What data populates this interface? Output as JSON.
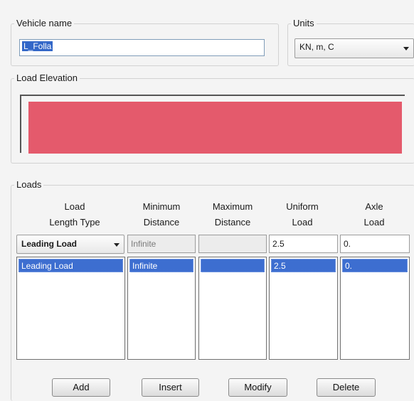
{
  "vehicle": {
    "title": "Vehicle name",
    "value": "L_Folla"
  },
  "units": {
    "title": "Units",
    "selected": "KN, m, C"
  },
  "elevation": {
    "title": "Load Elevation",
    "bar_color": "#e45a6c"
  },
  "loads": {
    "title": "Loads",
    "columns": [
      {
        "line1": "Load",
        "line2": "Length Type"
      },
      {
        "line1": "Minimum",
        "line2": "Distance"
      },
      {
        "line1": "Maximum",
        "line2": "Distance"
      },
      {
        "line1": "Uniform",
        "line2": "Load"
      },
      {
        "line1": "Axle",
        "line2": "Load"
      }
    ],
    "edit_row": {
      "length_type": "Leading Load",
      "min_distance": "Infinite",
      "max_distance": "",
      "uniform_load": "2.5",
      "axle_load": "0."
    },
    "rows": [
      {
        "length_type": "Leading Load",
        "min_distance": "Infinite",
        "max_distance": "",
        "uniform_load": "2.5",
        "axle_load": "0."
      }
    ]
  },
  "buttons": {
    "add": "Add",
    "insert": "Insert",
    "modify": "Modify",
    "delete": "Delete"
  },
  "colors": {
    "selection": "#3d6ed0",
    "accent_text_selected": "#ffffff"
  }
}
